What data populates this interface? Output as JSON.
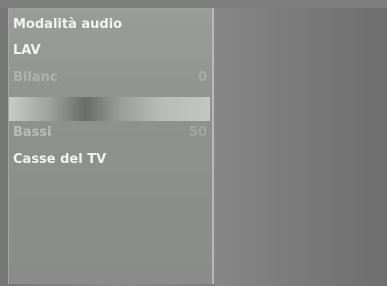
{
  "menu": {
    "items": [
      {
        "label": "Modalità audio",
        "value": ""
      },
      {
        "label": "LAV",
        "value": ""
      },
      {
        "label": "Bilanc",
        "value": "0"
      },
      {
        "label": "Bassi",
        "value": "50"
      },
      {
        "label": "Casse del TV",
        "value": ""
      }
    ]
  }
}
